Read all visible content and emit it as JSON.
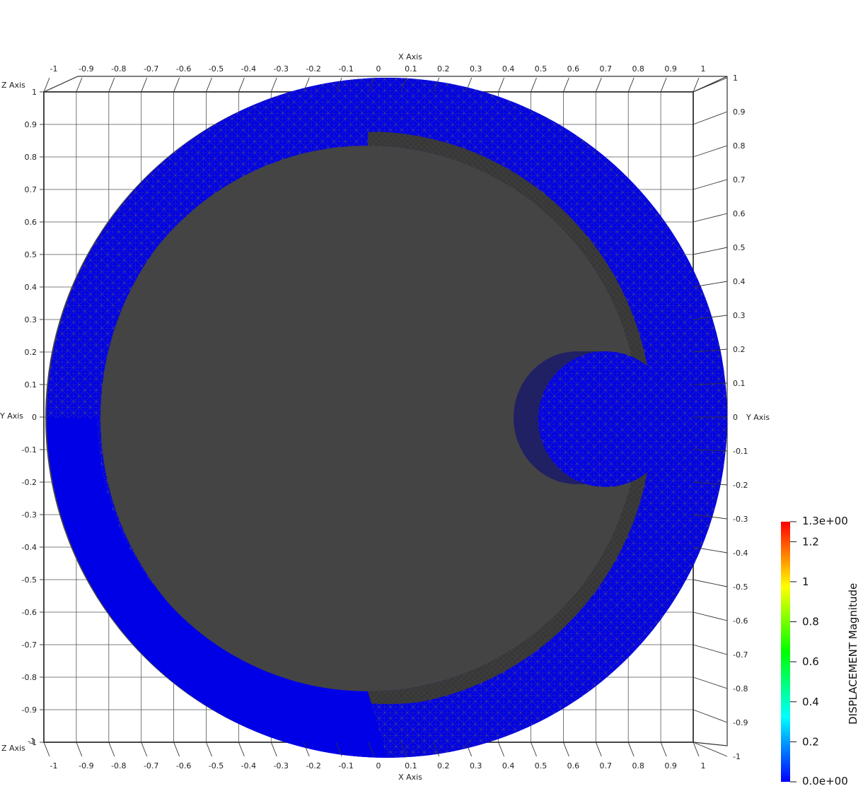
{
  "axes": {
    "x_title": "X Axis",
    "y_title": "Y Axis",
    "z_title": "Z Axis",
    "x_ticks": [
      "-1",
      "-0.9",
      "-0.8",
      "-0.7",
      "-0.6",
      "-0.5",
      "-0.4",
      "-0.3",
      "-0.2",
      "-0.1",
      "0",
      "0.1",
      "0.2",
      "0.3",
      "0.4",
      "0.5",
      "0.6",
      "0.7",
      "0.8",
      "0.9",
      "1"
    ],
    "z_ticks": [
      "1",
      "0.9",
      "0.8",
      "0.7",
      "0.6",
      "0.5",
      "0.4",
      "0.3",
      "0.2",
      "0.1",
      "0",
      "-0.1",
      "-0.2",
      "-0.3",
      "-0.4",
      "-0.5",
      "-0.6",
      "-0.7",
      "-0.8",
      "-0.9",
      "-1"
    ],
    "y_ticks": [
      "1",
      "0.9",
      "0.8",
      "0.7",
      "0.6",
      "0.5",
      "0.4",
      "0.3",
      "0.2",
      "0.1",
      "0",
      "-0.1",
      "-0.2",
      "-0.3",
      "-0.4",
      "-0.5",
      "-0.6",
      "-0.7",
      "-0.8",
      "-0.9",
      "-1"
    ],
    "z_bottom_extra": "-1",
    "grid": true
  },
  "colorbar": {
    "title": "DISPLACEMENT Magnitude",
    "max_label": "1.3e+00",
    "min_label": "0.0e+00",
    "tick_labels": [
      "1.2",
      "1",
      "0.8",
      "0.6",
      "0.4",
      "0.2"
    ],
    "range": [
      0,
      1.3
    ],
    "colors": [
      "#0000ff",
      "#00ffff",
      "#00ff00",
      "#ffff00",
      "#ff0000"
    ]
  },
  "model": {
    "surface_color": "#0000e6",
    "wall_color": "#4a4a4a",
    "mesh_color": "#6b6b4a"
  }
}
